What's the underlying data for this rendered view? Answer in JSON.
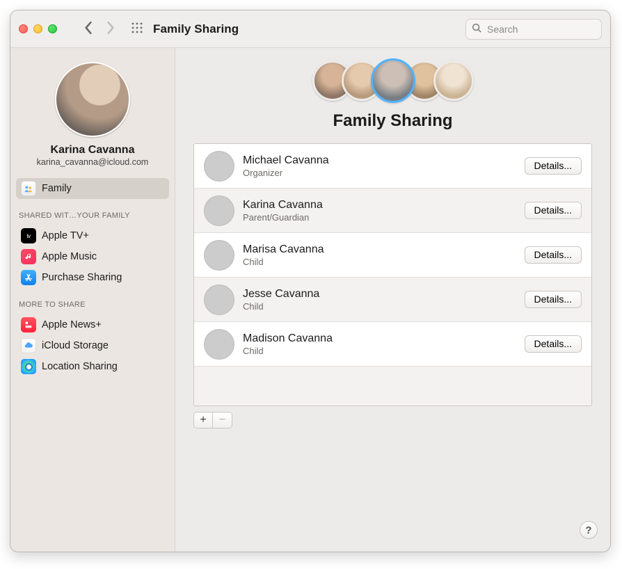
{
  "window": {
    "title": "Family Sharing"
  },
  "search": {
    "placeholder": "Search"
  },
  "profile": {
    "name": "Karina Cavanna",
    "email": "karina_cavanna@icloud.com"
  },
  "sidebar": {
    "primary": {
      "label": "Family"
    },
    "shared_header": "SHARED WIT…YOUR FAMILY",
    "shared": [
      {
        "label": "Apple TV+"
      },
      {
        "label": "Apple Music"
      },
      {
        "label": "Purchase Sharing"
      }
    ],
    "more_header": "MORE TO SHARE",
    "more": [
      {
        "label": "Apple News+"
      },
      {
        "label": "iCloud Storage"
      },
      {
        "label": "Location Sharing"
      }
    ]
  },
  "hero": {
    "title": "Family Sharing"
  },
  "members": [
    {
      "name": "Michael Cavanna",
      "role": "Organizer",
      "action": "Details..."
    },
    {
      "name": "Karina Cavanna",
      "role": "Parent/Guardian",
      "action": "Details..."
    },
    {
      "name": "Marisa Cavanna",
      "role": "Child",
      "action": "Details..."
    },
    {
      "name": "Jesse Cavanna",
      "role": "Child",
      "action": "Details..."
    },
    {
      "name": "Madison Cavanna",
      "role": "Child",
      "action": "Details..."
    }
  ],
  "help": {
    "label": "?"
  }
}
